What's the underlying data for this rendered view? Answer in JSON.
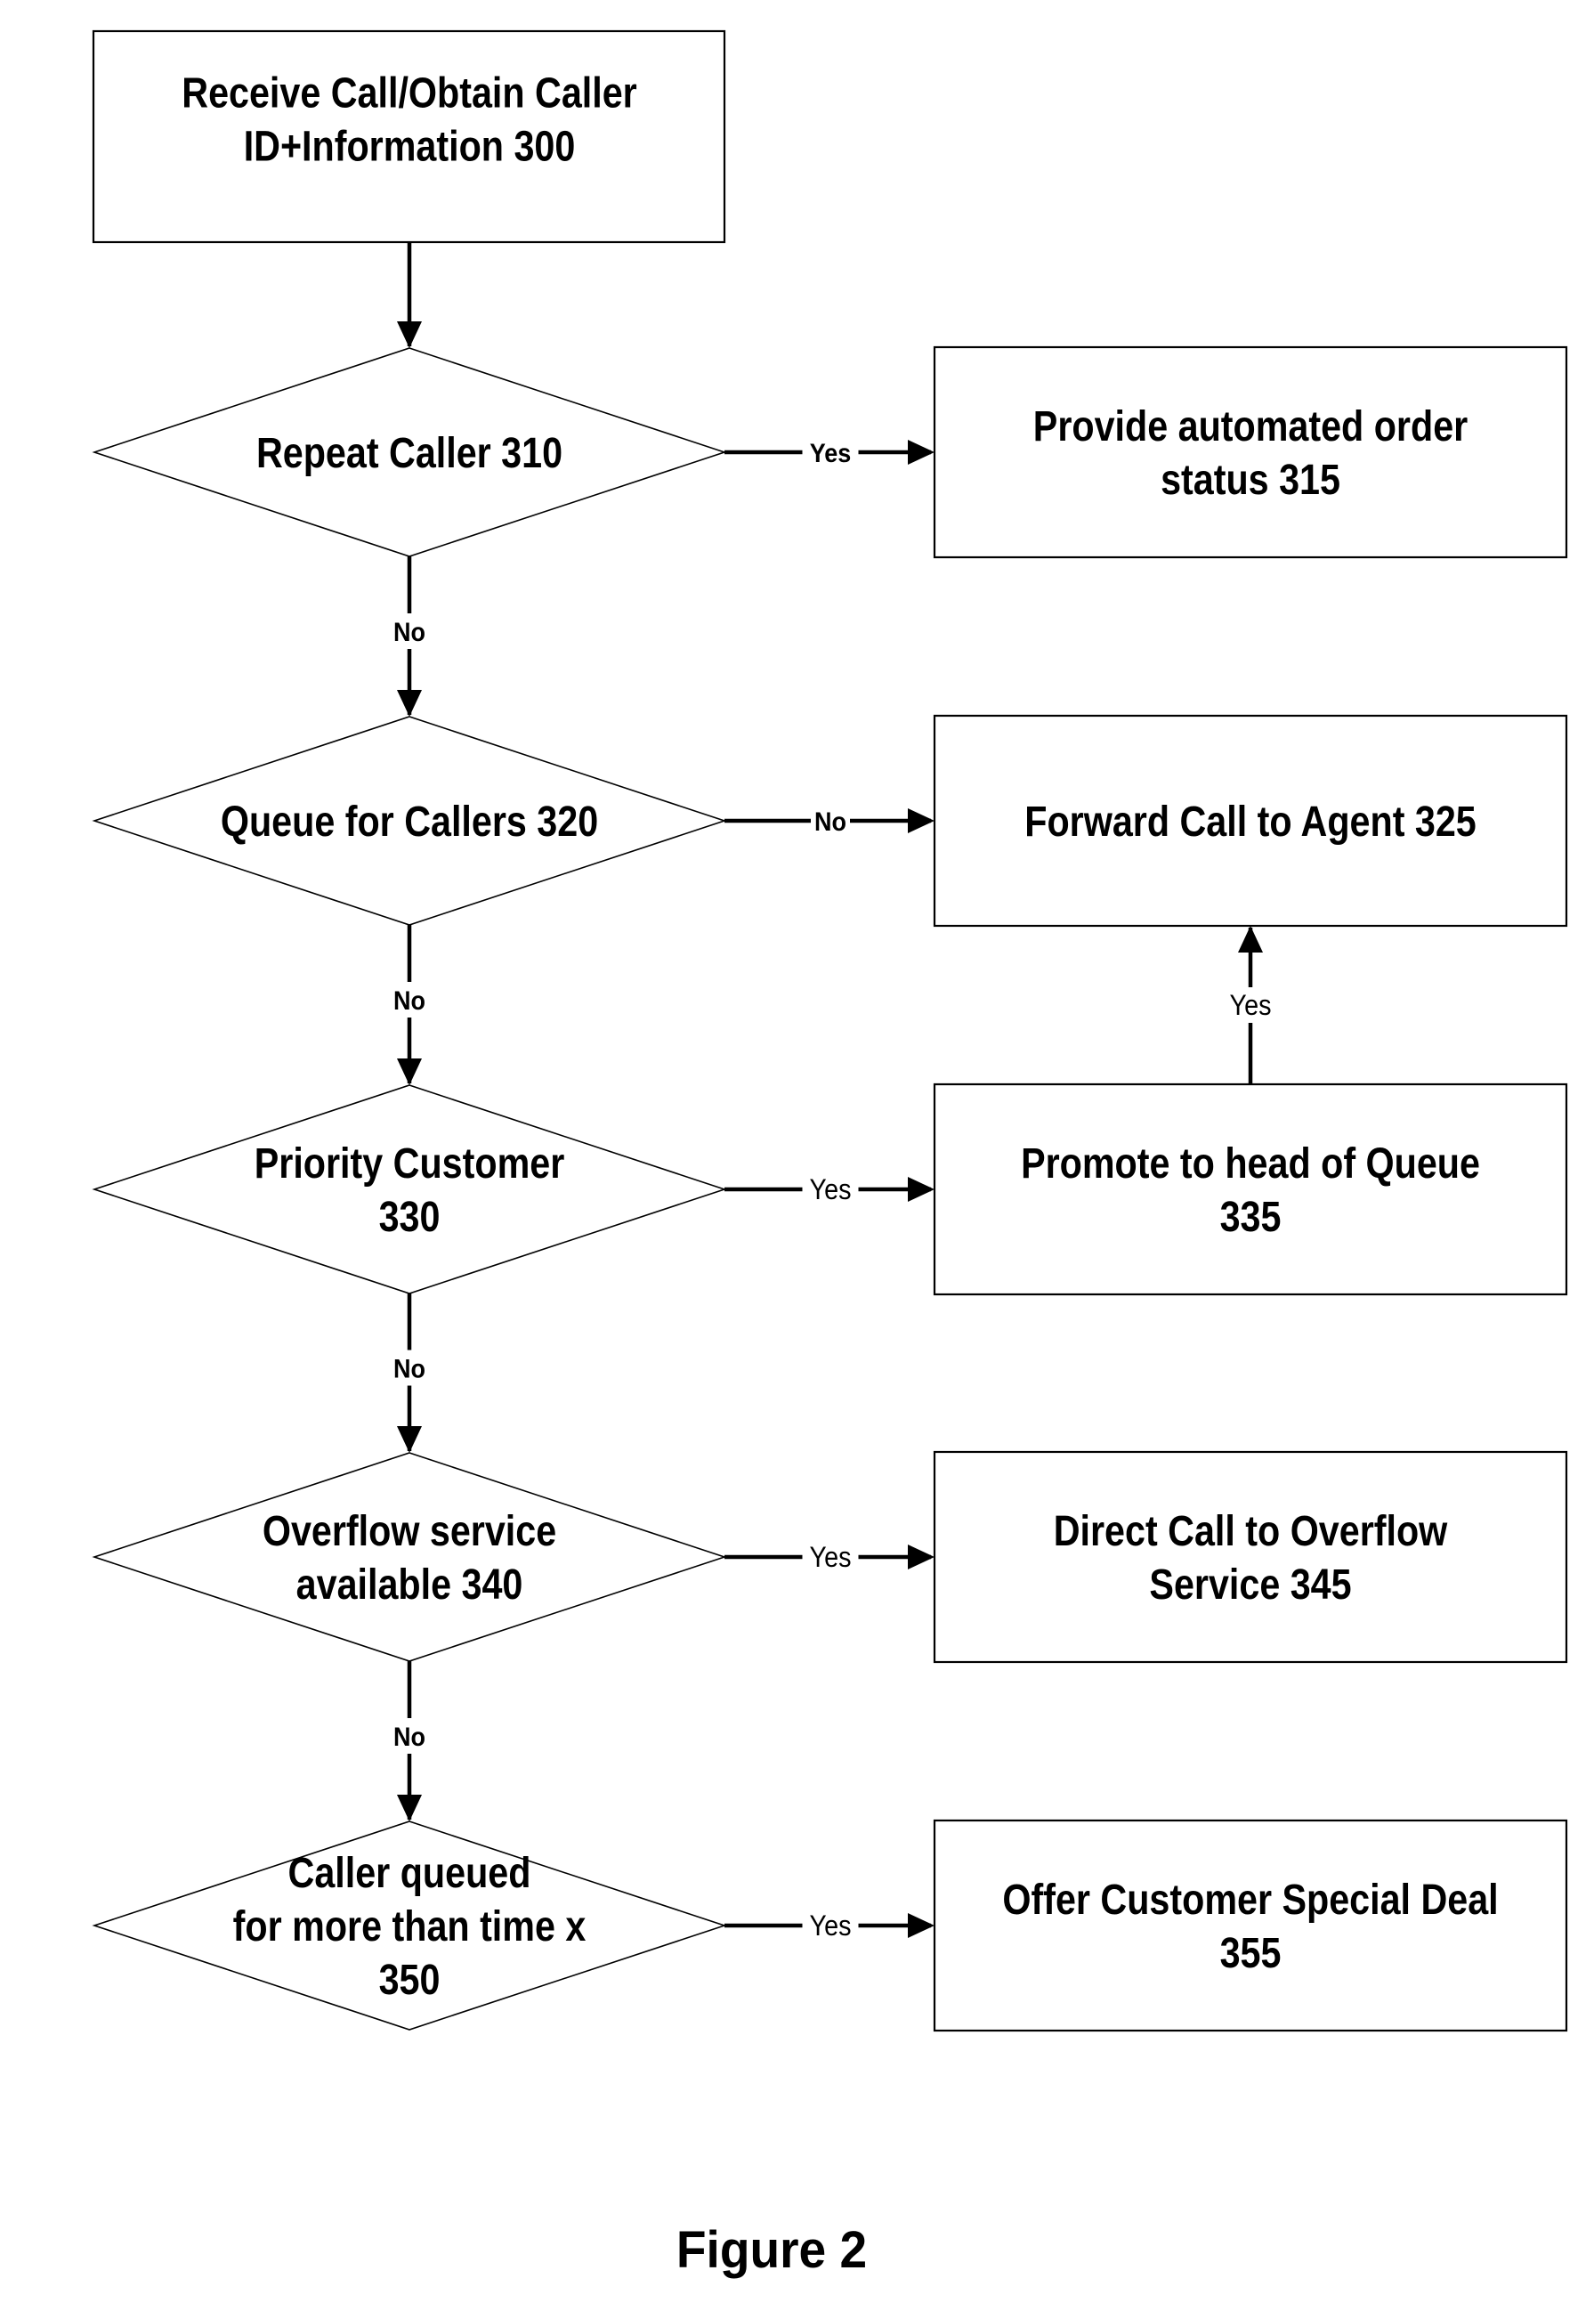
{
  "figure": {
    "caption": "Figure 2",
    "start_node": {
      "id": "300",
      "lines": [
        "Receive Call/Obtain Caller",
        "ID+Information 300"
      ]
    },
    "decisions": [
      {
        "id": "310",
        "lines": [
          "Repeat Caller 310"
        ],
        "branch_label": "Yes",
        "branch_label_bold": true,
        "down_label": "No",
        "action": {
          "id": "315",
          "lines": [
            "Provide automated order",
            "status 315"
          ]
        }
      },
      {
        "id": "320",
        "lines": [
          "Queue for Callers 320"
        ],
        "branch_label": "No",
        "branch_label_bold": true,
        "down_label": "No",
        "action": {
          "id": "325",
          "lines": [
            "Forward Call to Agent 325"
          ]
        }
      },
      {
        "id": "330",
        "lines": [
          "Priority Customer",
          "330"
        ],
        "branch_label": "Yes",
        "branch_label_bold": false,
        "down_label": "No",
        "action": {
          "id": "335",
          "lines": [
            "Promote to head of Queue",
            "335"
          ]
        }
      },
      {
        "id": "340",
        "lines": [
          "Overflow service",
          "available 340"
        ],
        "branch_label": "Yes",
        "branch_label_bold": false,
        "down_label": "No",
        "action": {
          "id": "345",
          "lines": [
            "Direct Call to Overflow",
            "Service 345"
          ]
        }
      },
      {
        "id": "350",
        "lines": [
          "Caller queued",
          "for more than time x",
          "350"
        ],
        "branch_label": "Yes",
        "branch_label_bold": false,
        "down_label": null,
        "action": {
          "id": "355",
          "lines": [
            "Offer Customer Special Deal",
            "355"
          ]
        }
      }
    ],
    "extra_edges": [
      {
        "from": "335",
        "to": "325",
        "label": "Yes",
        "label_bold": false
      }
    ]
  }
}
